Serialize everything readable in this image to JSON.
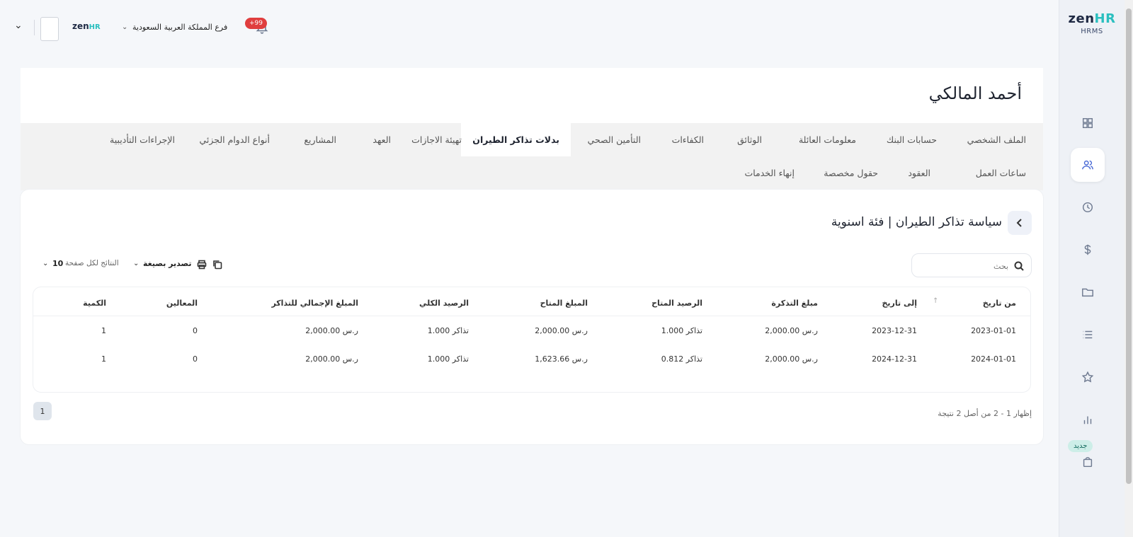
{
  "brand": {
    "name_main": "zen",
    "name_accent": "HR",
    "sub": "HRMS"
  },
  "topbar": {
    "branch": "فرع المملكة العربية السعودية",
    "notifications_count": "+99"
  },
  "employee": {
    "name": "أحمد المالكي"
  },
  "tabs_row1": [
    "الملف الشخصي",
    "حسابات البنك",
    "معلومات العائلة",
    "الوثائق",
    "الكفاءات",
    "التأمين الصحي",
    "بدلات تذاكر الطيران",
    "تهيئة الاجازات",
    "العهد",
    "المشاريع",
    "أنواع الدوام الجزئي",
    "الإجراءات التأديبية"
  ],
  "tabs_row2": [
    "ساعات العمل",
    "العقود",
    "حقول مخصصة",
    "إنهاء الخدمات"
  ],
  "active_tab": "بدلات تذاكر الطيران",
  "policy": {
    "title": "سياسة تذاكر الطيران | فئة اسنوية"
  },
  "search": {
    "placeholder": "بحث",
    "value": ""
  },
  "toolbar": {
    "per_page_label": "النتائج لكل صفحة",
    "per_page_value": "10",
    "export_label": "تصدير بصيغة"
  },
  "table": {
    "columns": [
      "من تاريخ",
      "إلى تاريخ",
      "مبلغ التذكرة",
      "الرصيد المتاح",
      "المبلغ المتاح",
      "الرصيد الكلي",
      "المبلغ الإجمالي للتذاكر",
      "المعالين",
      "الكمية"
    ],
    "rows": [
      [
        "2023-01-01",
        "2023-12-31",
        "2,000.00 ر.س",
        "1.000 تذاكر",
        "2,000.00 ر.س",
        "1.000 تذاكر",
        "2,000.00 ر.س",
        "0",
        "1"
      ],
      [
        "2024-01-01",
        "2024-12-31",
        "2,000.00 ر.س",
        "0.812 تذاكر",
        "1,623.66 ر.س",
        "1.000 تذاكر",
        "2,000.00 ر.س",
        "0",
        "1"
      ]
    ]
  },
  "pagination": {
    "info": "إظهار 1 - 2 من أصل 2 نتيجة",
    "current_page": "1"
  },
  "sidebar": {
    "new_badge": "جديد"
  }
}
